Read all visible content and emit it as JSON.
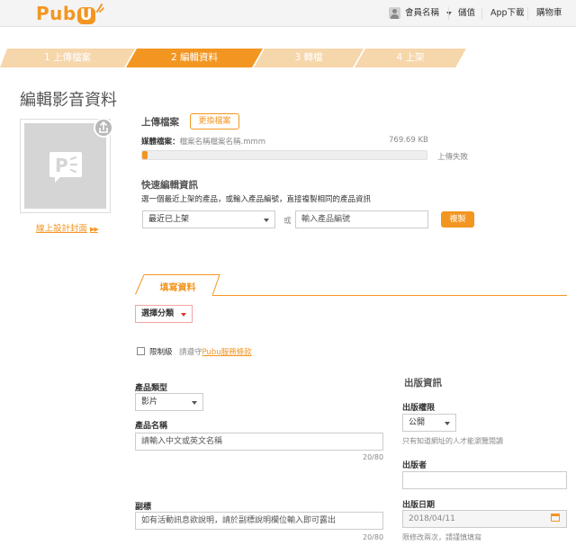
{
  "header": {
    "logo_text": "Pub",
    "logo_u": "U",
    "member_name": "會員名稱",
    "nav": [
      "儲值",
      "App下載",
      "購物車"
    ]
  },
  "steps": [
    "1 上傳檔案",
    "2 編輯資料",
    "3 轉檔",
    "4 上架"
  ],
  "active_step": 1,
  "page_title": "編輯影音資料",
  "cover": {
    "link_label": "線上設計封面",
    "link_arrows": "▶▶"
  },
  "upload": {
    "title": "上傳檔案",
    "replace_button": "更換檔案",
    "file_label": "媒體檔案：",
    "file_name": "檔案名稱檔案名稱.mmm",
    "file_size": "769.69 KB",
    "progress": 0.02,
    "status": "上傳失敗"
  },
  "quick_edit": {
    "title": "快速編輯資訊",
    "hint": "選一個最近上架的產品，或輸入產品編號，直接複製相同的產品資訊",
    "select_value": "最近已上架",
    "or_label": "或",
    "input_placeholder": "輸入產品編號",
    "copy_button": "複製"
  },
  "form": {
    "tab_label": "填寫資料",
    "category_select": "選擇分類",
    "restricted_label": "限制級",
    "restricted_hint_prefix": "請遵守",
    "restricted_link": "Pubu服務條款",
    "product_type_label": "產品類型",
    "product_type_value": "影片",
    "product_name_label": "產品名稱",
    "product_name_placeholder": "請輸入中文或英文名稱",
    "product_name_counter": "20/80",
    "subtitle_label": "副標",
    "subtitle_placeholder": "如有活動訊息欲說明，請於副標說明欄位輸入即可露出",
    "subtitle_counter": "20/80"
  },
  "publish": {
    "title": "出版資訊",
    "permission_label": "出版權限",
    "permission_value": "公開",
    "permission_hint": "只有知道網址的人才能瀏覽閱讀",
    "publisher_label": "出版者",
    "date_label": "出版日期",
    "date_value": "2018/04/11",
    "date_hint": "限修改兩次，請謹慎填寫"
  },
  "colors": {
    "accent": "#f39621",
    "step_inactive": "#f6d6ab"
  }
}
